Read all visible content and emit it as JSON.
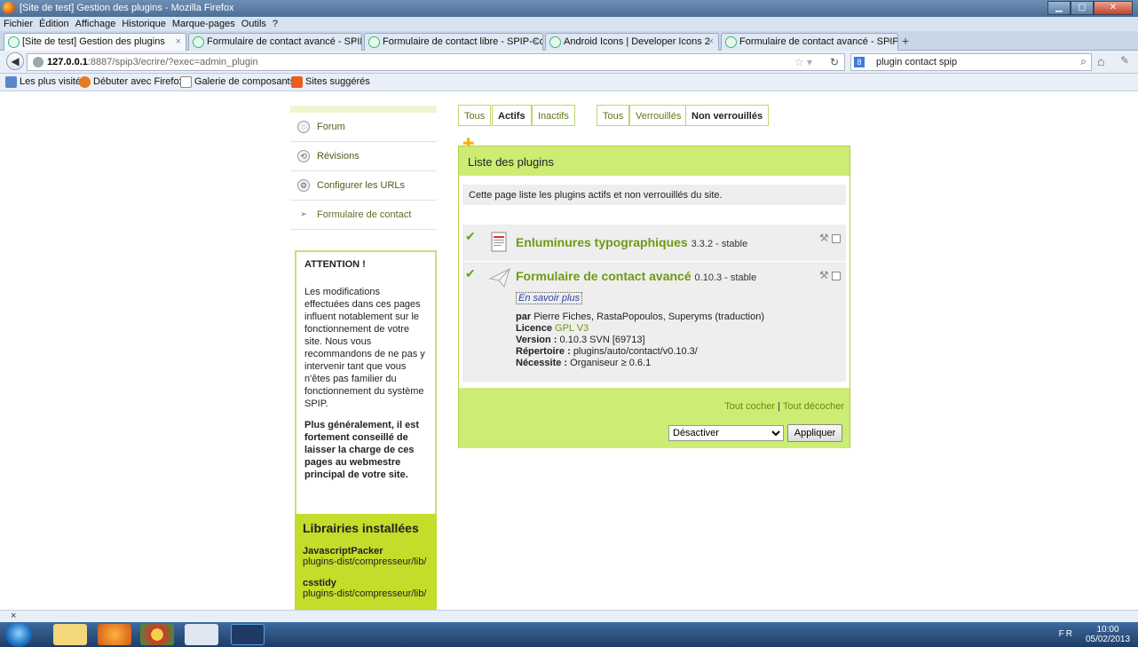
{
  "window": {
    "title": "[Site de test] Gestion des plugins - Mozilla Firefox"
  },
  "menubar": {
    "items": [
      "Fichier",
      "Édition",
      "Affichage",
      "Historique",
      "Marque-pages",
      "Outils",
      "?"
    ]
  },
  "tabs": [
    {
      "label": "[Site de test] Gestion des plugins",
      "active": true
    },
    {
      "label": "Formulaire de contact avancé - SPIP-...",
      "active": false
    },
    {
      "label": "Formulaire de contact libre - SPIP-Co...",
      "active": false
    },
    {
      "label": "Android Icons | Developer Icons 2",
      "active": false
    },
    {
      "label": "Formulaire de contact avancé - SPIP-...",
      "active": false
    }
  ],
  "navbar": {
    "url_host": "127.0.0.1",
    "url_rest": ":8887/spip3/ecrire/?exec=admin_plugin",
    "search_value": "plugin contact spip"
  },
  "bookmarks": [
    {
      "label": "Les plus visités"
    },
    {
      "label": "Débuter avec Firefox"
    },
    {
      "label": "Galerie de composants..."
    },
    {
      "label": "Sites suggérés"
    }
  ],
  "sidenav": {
    "items": [
      {
        "label": "Forum",
        "icon": "speech-bubble-icon"
      },
      {
        "label": "Révisions",
        "icon": "revisions-icon"
      },
      {
        "label": "Configurer les URLs",
        "icon": "url-config-icon"
      },
      {
        "label": "Formulaire de contact",
        "icon": "paper-plane-icon"
      }
    ]
  },
  "warning": {
    "title": "ATTENTION !",
    "text": "Les modifications effectuées dans ces pages influent notablement sur le fonctionnement de votre site. Nous vous recommandons de ne pas y intervenir tant que vous n'êtes pas familier du fonctionnement du système SPIP.",
    "bold": "Plus généralement, il est fortement conseillé de laisser la charge de ces pages au webmestre principal de votre site."
  },
  "libraries": {
    "title": "Librairies installées",
    "items": [
      {
        "name": "JavascriptPacker",
        "path": "plugins-dist/compresseur/lib/"
      },
      {
        "name": "csstidy",
        "path": "plugins-dist/compresseur/lib/"
      }
    ]
  },
  "filters": {
    "state": [
      "Tous",
      "Actifs",
      "Inactifs"
    ],
    "lock": [
      "Tous",
      "Verrouillés",
      "Non verrouillés"
    ]
  },
  "plugins_panel": {
    "title": "Liste des plugins",
    "info": "Cette page liste les plugins actifs et non verrouillés du site.",
    "plugins": [
      {
        "name": "Enluminures typographiques",
        "version": "3.3.2 - stable"
      },
      {
        "name": "Formulaire de contact avancé",
        "version": "0.10.3 - stable",
        "more": "En savoir plus",
        "by_label": "par",
        "by": "Pierre Fiches, RastaPopoulos, Superyms (traduction)",
        "licence_label": "Licence",
        "licence": "GPL V3",
        "version_label": "Version :",
        "version_full": "0.10.3 SVN [69713]",
        "dir_label": "Répertoire :",
        "dir": "plugins/auto/contact/v0.10.3/",
        "needs_label": "Nécessite :",
        "needs": "Organiseur ≥ 0.6.1"
      }
    ],
    "check_all": "Tout cocher",
    "uncheck_all": "Tout décocher",
    "action_selected": "Désactiver",
    "apply": "Appliquer"
  },
  "taskbar": {
    "lang": "FR",
    "time": "10:00",
    "date": "05/02/2013"
  }
}
